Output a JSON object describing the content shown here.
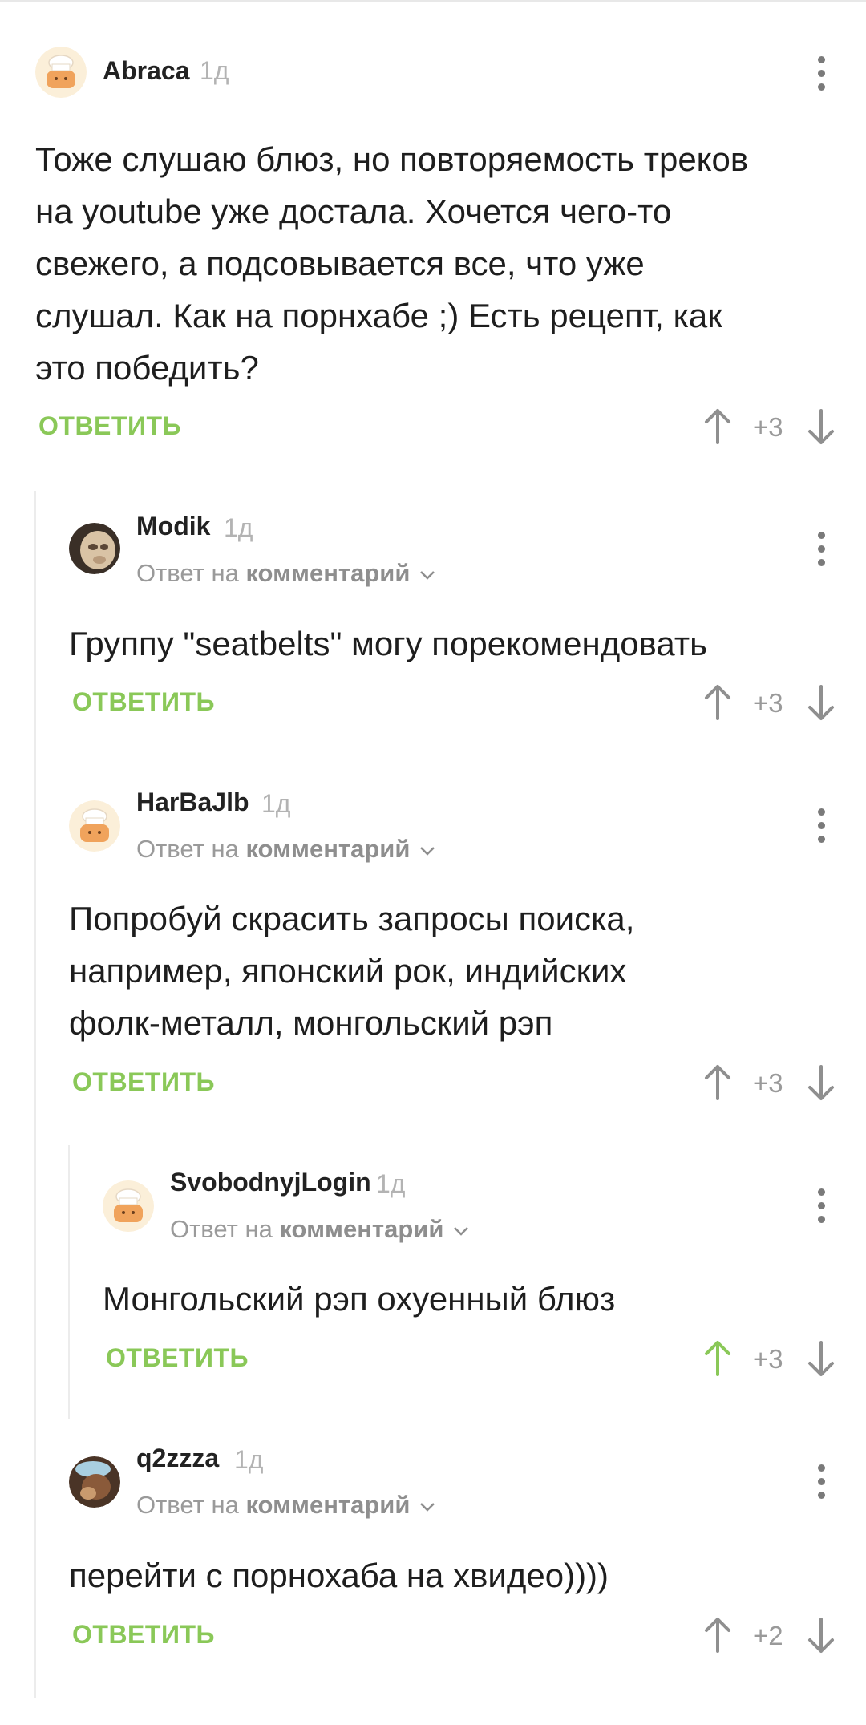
{
  "colors": {
    "accent_green": "#8ac858",
    "text": "#1e1e1e",
    "muted": "#9a9a9a",
    "thread_line": "#ececec"
  },
  "comments": [
    {
      "author": "Abraca",
      "time": "1д",
      "avatar_icon": "chef-avatar-icon",
      "text_lines": [
        "Тоже слушаю блюз, но повторяемость треков",
        "на youtube уже достала. Хочется чего-то",
        "свежего, а подсовывается все, что уже",
        "слушал. Как на порнхабе ;) Есть рецепт, как",
        "это победить?"
      ],
      "reply_label": "ОТВЕТИТЬ",
      "score": "+3",
      "upvoted": false
    },
    {
      "author": "Modik",
      "time": "1д",
      "avatar_icon": "photo-avatar-icon",
      "reply_to_prefix": "Ответ на",
      "reply_to_target": "комментарий",
      "text_lines": [
        "Группу \"seatbelts\" могу порекомендовать"
      ],
      "reply_label": "ОТВЕТИТЬ",
      "score": "+3",
      "upvoted": false
    },
    {
      "author": "HarBaJlb",
      "time": "1д",
      "avatar_icon": "chef-avatar-icon",
      "reply_to_prefix": "Ответ на",
      "reply_to_target": "комментарий",
      "text_lines": [
        "Попробуй скрасить запросы поиска,",
        "например, японский рок, индийских",
        "фолк-металл, монгольский рэп"
      ],
      "reply_label": "ОТВЕТИТЬ",
      "score": "+3",
      "upvoted": false
    },
    {
      "author": "SvobodnyjLogin",
      "time": "1д",
      "avatar_icon": "chef-avatar-icon",
      "reply_to_prefix": "Ответ на",
      "reply_to_target": "комментарий",
      "text_lines": [
        "Монгольский рэп охуенный блюз"
      ],
      "reply_label": "ОТВЕТИТЬ",
      "score": "+3",
      "upvoted": true
    },
    {
      "author": "q2zzza",
      "time": "1д",
      "avatar_icon": "photo-avatar-icon",
      "reply_to_prefix": "Ответ на",
      "reply_to_target": "комментарий",
      "text_lines": [
        "перейти с порнохаба на хвидео))))"
      ],
      "reply_label": "ОТВЕТИТЬ",
      "score": "+2",
      "upvoted": false
    }
  ]
}
